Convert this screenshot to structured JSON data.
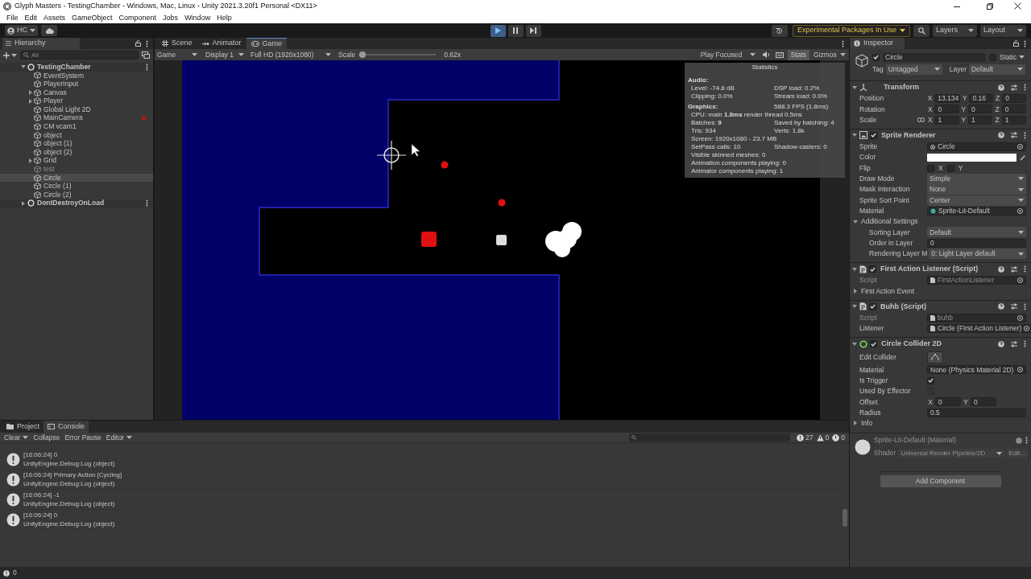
{
  "window": {
    "title": "Glyph Masters - TestingChamber - Windows, Mac, Linux - Unity 2021.3.20f1 Personal <DX11>"
  },
  "menu": [
    "File",
    "Edit",
    "Assets",
    "GameObject",
    "Component",
    "Jobs",
    "Window",
    "Help"
  ],
  "toolbar": {
    "account": "HC",
    "playing": true,
    "paused": false,
    "experimental": "Experimental Packages In Use",
    "layers": "Layers",
    "layout": "Layout"
  },
  "hierarchy": {
    "title": "Hierarchy",
    "search_placeholder": "All",
    "scenes": [
      {
        "name": "TestingChamber",
        "expanded": true,
        "children": [
          {
            "name": "EventSystem",
            "collapsible": false,
            "active": true,
            "selected": false,
            "marker": false
          },
          {
            "name": "PlayerInput",
            "collapsible": false,
            "active": true,
            "selected": false,
            "marker": false
          },
          {
            "name": "Canvas",
            "collapsible": true,
            "active": true,
            "selected": false,
            "marker": false
          },
          {
            "name": "Player",
            "collapsible": true,
            "active": true,
            "selected": false,
            "marker": false
          },
          {
            "name": "Global Light 2D",
            "collapsible": false,
            "active": true,
            "selected": false,
            "marker": false
          },
          {
            "name": "MainCamera",
            "collapsible": false,
            "active": true,
            "selected": false,
            "marker": true
          },
          {
            "name": "CM vcam1",
            "collapsible": false,
            "active": true,
            "selected": false,
            "marker": false
          },
          {
            "name": "object",
            "collapsible": false,
            "active": true,
            "selected": false,
            "marker": false
          },
          {
            "name": "object (1)",
            "collapsible": false,
            "active": true,
            "selected": false,
            "marker": false
          },
          {
            "name": "object (2)",
            "collapsible": false,
            "active": true,
            "selected": false,
            "marker": false
          },
          {
            "name": "Grid",
            "collapsible": true,
            "active": true,
            "selected": false,
            "marker": false
          },
          {
            "name": "test",
            "collapsible": false,
            "active": false,
            "selected": false,
            "marker": false
          },
          {
            "name": "Circle",
            "collapsible": false,
            "active": true,
            "selected": true,
            "marker": false
          },
          {
            "name": "Circle (1)",
            "collapsible": false,
            "active": true,
            "selected": false,
            "marker": false
          },
          {
            "name": "Circle (2)",
            "collapsible": false,
            "active": true,
            "selected": false,
            "marker": false
          }
        ]
      },
      {
        "name": "DontDestroyOnLoad",
        "expanded": false
      }
    ]
  },
  "game": {
    "tabs": [
      {
        "label": "Scene",
        "kind": "scene",
        "selected": false
      },
      {
        "label": "Animator",
        "kind": "animator",
        "selected": false
      },
      {
        "label": "Game",
        "kind": "game",
        "selected": true
      }
    ],
    "view": "Game",
    "display": "Display 1",
    "resolution": "Full HD (1920x1080)",
    "scale_label": "Scale",
    "scale": {
      "level": 0.05
    },
    "scale_reading": "0.62x",
    "play_mode": "Play Focused",
    "stats_label": "Stats",
    "stats_on": true,
    "gizmos": "Gizmos",
    "statistics": [
      {
        "kind": "title",
        "text": "Statistics"
      },
      {
        "kind": "heading",
        "text": "Audio:"
      },
      {
        "kind": "pair",
        "left": "Level: -74.8 dB",
        "right": "DSP load: 0.2%"
      },
      {
        "kind": "pair",
        "left": "Clipping: 0.0%",
        "right": "Stream load: 0.0%"
      },
      {
        "kind": "heading",
        "text": "Graphics:",
        "right": "588.3 FPS (1.8ms)"
      },
      {
        "kind": "line",
        "text": "CPU: main **1.8ms** render thread 0.5ms"
      },
      {
        "kind": "pair",
        "left": "Batches: **9**",
        "right": "Saved by batching: 4"
      },
      {
        "kind": "pair",
        "left": "Tris: 934",
        "right": "Verts: 1.8k"
      },
      {
        "kind": "line",
        "text": "Screen: 1920x1080 - 23.7 MB"
      },
      {
        "kind": "pair",
        "left": "SetPass calls: 10",
        "right": "Shadow casters: 0"
      },
      {
        "kind": "line",
        "text": "Visible skinned meshes: 0"
      },
      {
        "kind": "line",
        "text": "Animation components playing: 0"
      },
      {
        "kind": "line",
        "text": "Animator components playing: 1"
      }
    ]
  },
  "inspector": {
    "title": "Inspector",
    "object": {
      "name": "Circle",
      "active": true,
      "static_label": "Static",
      "static": false,
      "tag_label": "Tag",
      "tag": "Untagged",
      "layer_label": "Layer",
      "layer": "Default"
    },
    "components": [
      {
        "kind": "transform",
        "title": "Transform",
        "expanded": true,
        "rows": [
          {
            "kind": "vector",
            "label": "Position",
            "linked": false,
            "axes": [
              {
                "axis": "X",
                "value": "13.134"
              },
              {
                "axis": "Y",
                "value": "0.16"
              },
              {
                "axis": "Z",
                "value": "0"
              }
            ]
          },
          {
            "kind": "vector",
            "label": "Rotation",
            "linked": false,
            "axes": [
              {
                "axis": "X",
                "value": "0"
              },
              {
                "axis": "Y",
                "value": "0"
              },
              {
                "axis": "Z",
                "value": "0"
              }
            ]
          },
          {
            "kind": "vector",
            "label": "Scale",
            "linked": true,
            "axes": [
              {
                "axis": "X",
                "value": "1"
              },
              {
                "axis": "Y",
                "value": "1"
              },
              {
                "axis": "Z",
                "value": "1"
              }
            ]
          }
        ]
      },
      {
        "kind": "sprite",
        "title": "Sprite Renderer",
        "enabled": true,
        "expanded": true,
        "rows": [
          {
            "kind": "object",
            "label": "Sprite",
            "value": "Circle",
            "disabled": false,
            "asset": {
              "kind": "sprite"
            }
          },
          {
            "kind": "color",
            "label": "Color",
            "color": "#ffffff"
          },
          {
            "kind": "flags",
            "label": "Flip",
            "flags": [
              {
                "label": "X",
                "checked": false
              },
              {
                "label": "Y",
                "checked": false
              }
            ]
          },
          {
            "kind": "dropdown",
            "label": "Draw Mode",
            "value": "Simple"
          },
          {
            "kind": "dropdown",
            "label": "Mask Interaction",
            "value": "None"
          },
          {
            "kind": "dropdown",
            "label": "Sprite Sort Point",
            "value": "Center"
          },
          {
            "kind": "object",
            "label": "Material",
            "value": "Sprite-Lit-Default",
            "disabled": false,
            "asset": {
              "kind": "material"
            }
          },
          {
            "kind": "foldout",
            "label": "Additional Settings",
            "expanded": true,
            "children": [
              {
                "kind": "dropdown",
                "label": "Sorting Layer",
                "value": "Default"
              },
              {
                "kind": "number",
                "label": "Order in Layer",
                "value": "0"
              },
              {
                "kind": "dropdown",
                "label": "Rendering Layer M",
                "value": "0: Light Layer default"
              }
            ]
          }
        ]
      },
      {
        "kind": "script",
        "title": "First Action Listener (Script)",
        "enabled": true,
        "expanded": true,
        "rows": [
          {
            "kind": "object",
            "label": "Script",
            "value": "FirstActionListener",
            "disabled": true,
            "asset": {
              "kind": "script"
            }
          },
          {
            "kind": "foldout",
            "label": "First Action Event",
            "expanded": false
          }
        ]
      },
      {
        "kind": "script",
        "title": "Buhb (Script)",
        "enabled": true,
        "expanded": true,
        "rows": [
          {
            "kind": "object",
            "label": "Script",
            "value": "buhb",
            "disabled": true,
            "asset": {
              "kind": "script"
            }
          },
          {
            "kind": "object",
            "label": "Listener",
            "value": "Circle (First Action Listener)",
            "disabled": false,
            "asset": {
              "kind": "script"
            }
          }
        ]
      },
      {
        "kind": "collider",
        "title": "Circle Collider 2D",
        "enabled": true,
        "expanded": true,
        "rows": [
          {
            "kind": "edit",
            "label": "Edit Collider"
          },
          {
            "kind": "object",
            "label": "Material",
            "value": "None (Physics Material 2D)",
            "disabled": false
          },
          {
            "kind": "check",
            "label": "Is Trigger",
            "checked": true,
            "disabled": false
          },
          {
            "kind": "check",
            "label": "Used By Effector",
            "checked": false,
            "disabled": true
          },
          {
            "kind": "vector",
            "label": "Offset",
            "linked": false,
            "axes": [
              {
                "axis": "X",
                "value": "0"
              },
              {
                "axis": "Y",
                "value": "0"
              }
            ]
          },
          {
            "kind": "number",
            "label": "Radius",
            "value": "0.5"
          },
          {
            "kind": "foldout",
            "label": "Info",
            "expanded": false
          }
        ]
      }
    ],
    "material": {
      "title": "Sprite-Lit-Default (Material)",
      "shader_label": "Shader",
      "shader": "Universal Render Pipeline/2D",
      "edit": "Edit..."
    },
    "add_component": "Add Component"
  },
  "console": {
    "tabs": [
      {
        "label": "Project",
        "kind": "project",
        "selected": false
      },
      {
        "label": "Console",
        "kind": "console",
        "selected": true
      }
    ],
    "toolbar": [
      {
        "label": "Clear",
        "dropdown": true
      },
      {
        "label": "Collapse",
        "dropdown": false
      },
      {
        "label": "Error Pause",
        "dropdown": false
      },
      {
        "label": "Editor",
        "dropdown": true
      }
    ],
    "counts": [
      {
        "kind": "info",
        "count": "27"
      },
      {
        "kind": "warning",
        "count": "0"
      },
      {
        "kind": "error",
        "count": "0"
      }
    ],
    "entries": [
      {
        "message": "[16:06:24] 0",
        "trace": "UnityEngine.Debug:Log (object)"
      },
      {
        "message": "[16:06:24] Primary Action [Cycling]",
        "trace": "UnityEngine.Debug:Log (object)"
      },
      {
        "message": "[16:06:24] -1",
        "trace": "UnityEngine.Debug:Log (object)"
      },
      {
        "message": "[16:06:24] 0",
        "trace": "UnityEngine.Debug:Log (object)"
      }
    ]
  },
  "status_bar": {
    "message": "0"
  }
}
